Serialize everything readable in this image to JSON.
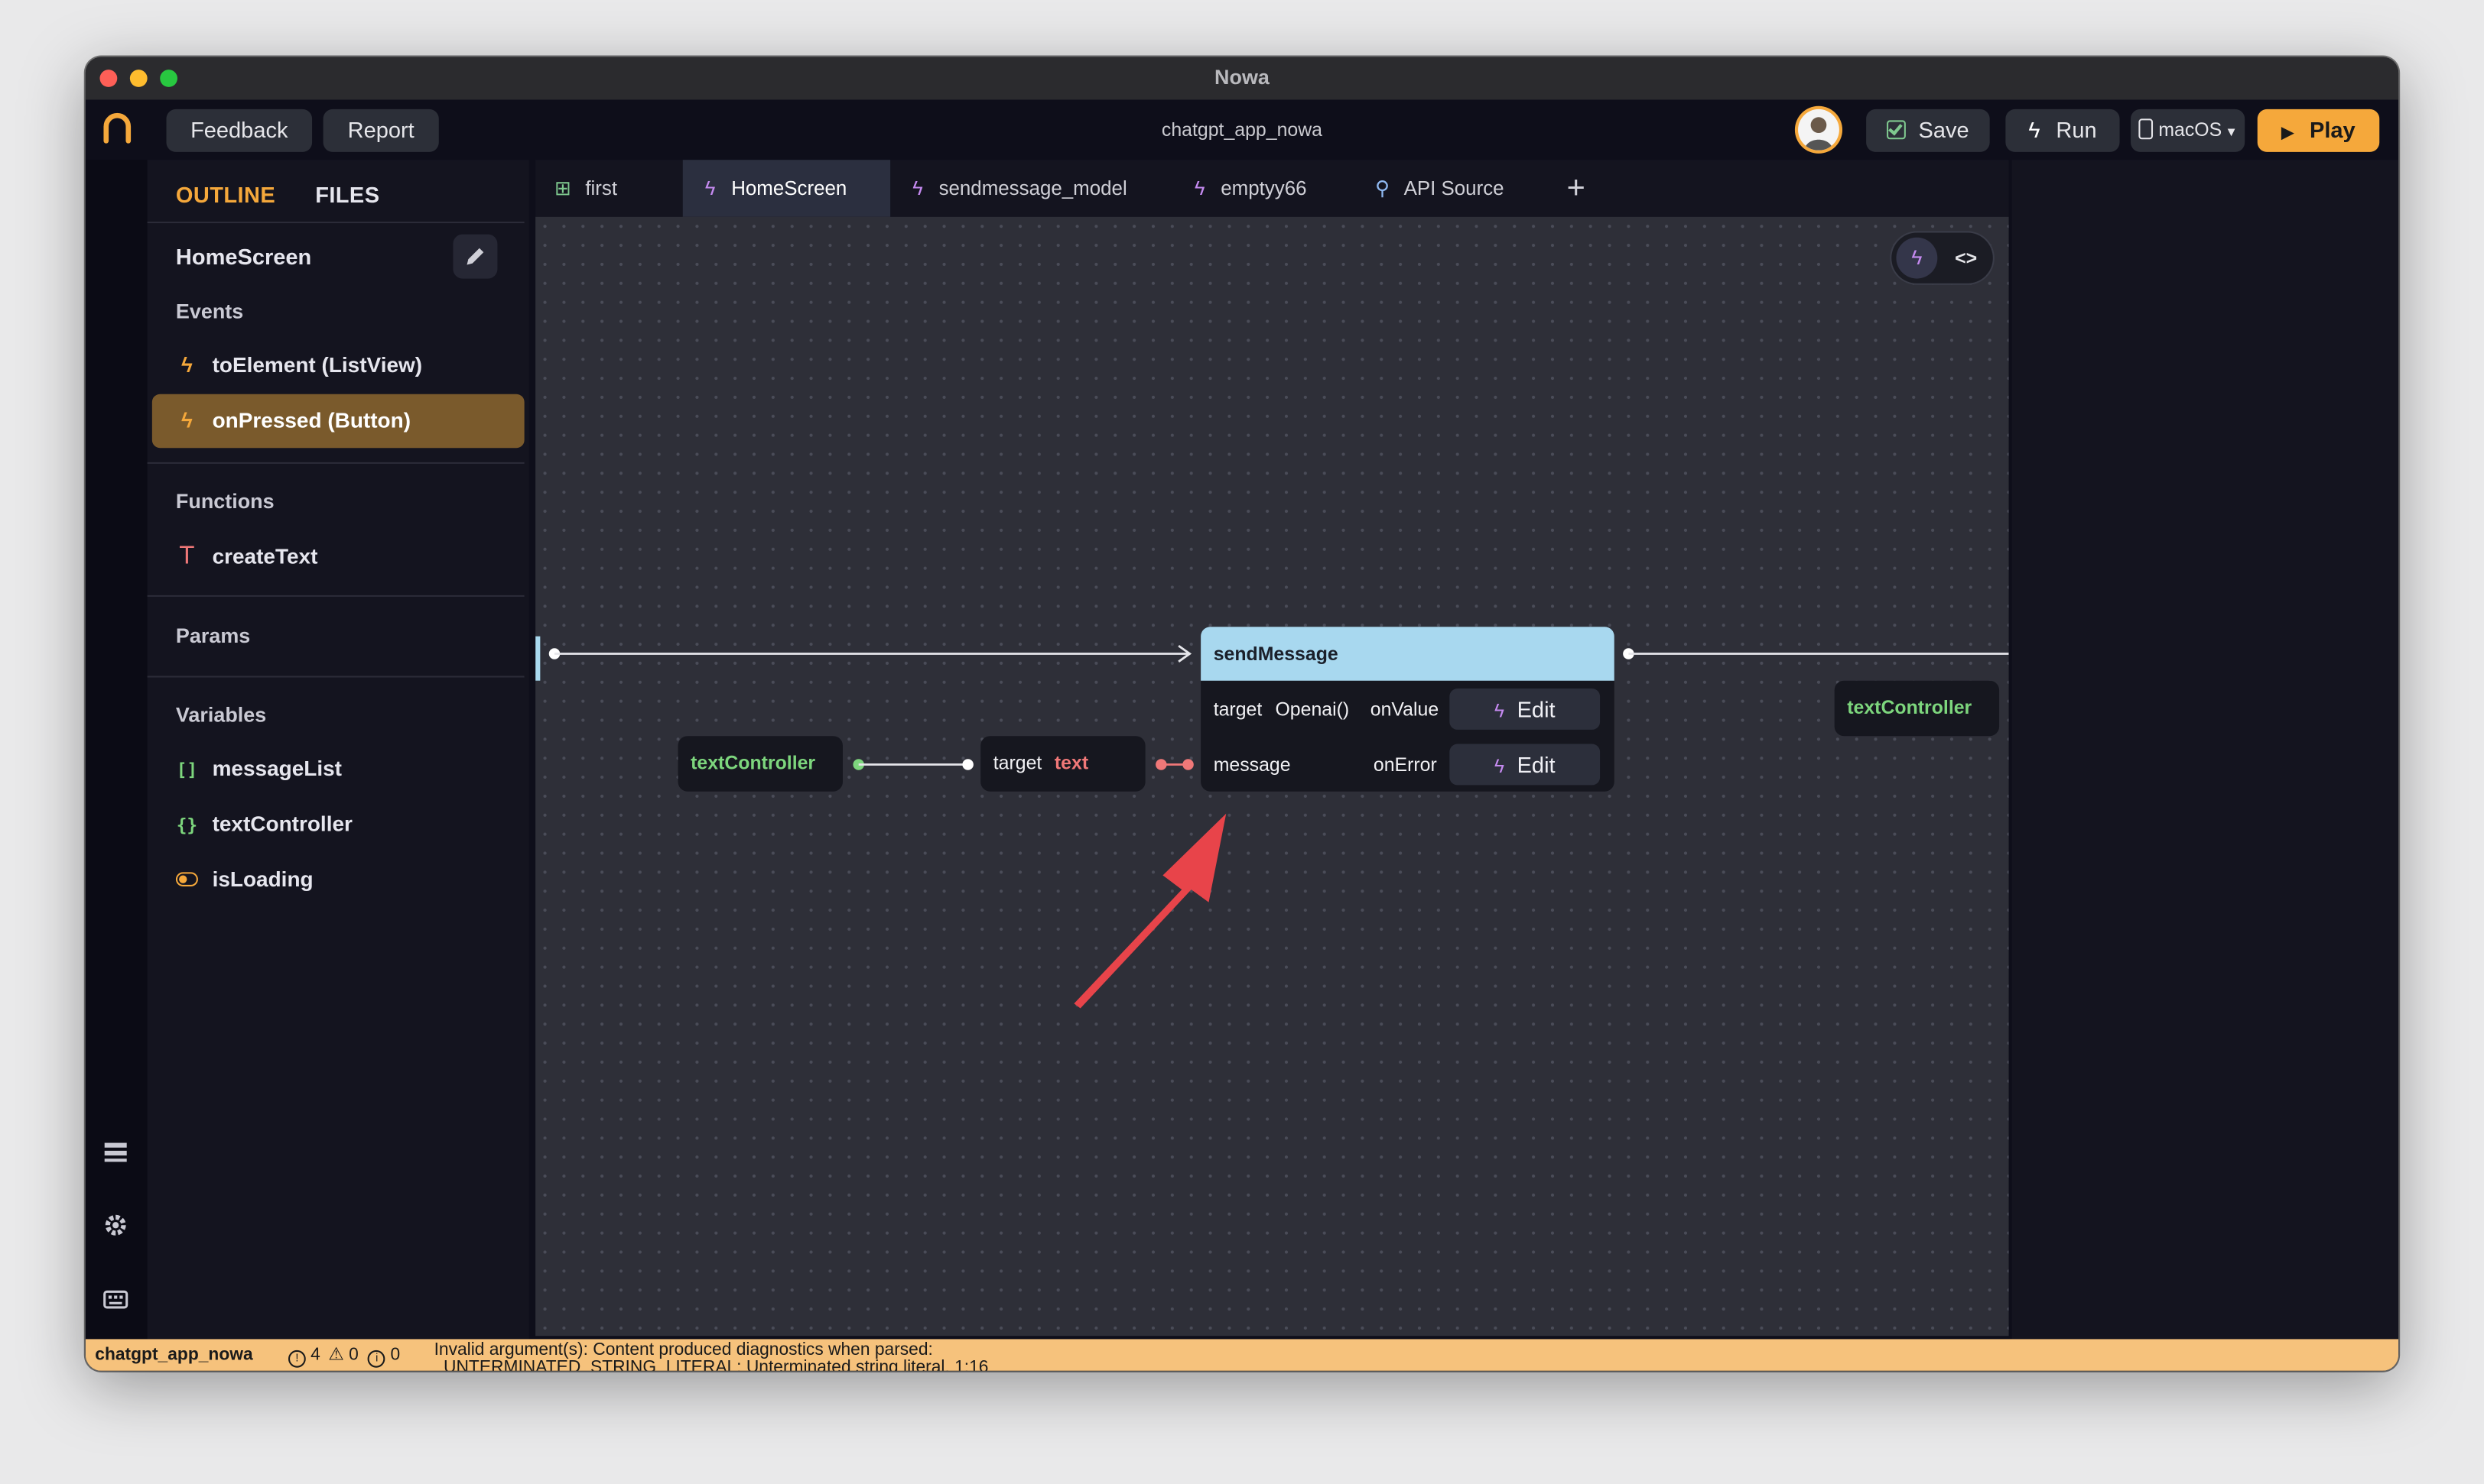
{
  "window": {
    "title": "Nowa"
  },
  "toolbar": {
    "feedback_label": "Feedback",
    "report_label": "Report",
    "project_title": "chatgpt_app_nowa",
    "save_label": "Save",
    "run_label": "Run",
    "platform_label": "macOS",
    "play_label": "Play"
  },
  "sidebar": {
    "tabs": [
      {
        "label": "OUTLINE",
        "active": true
      },
      {
        "label": "FILES",
        "active": false
      }
    ],
    "screen_name": "HomeScreen",
    "events_label": "Events",
    "events": [
      {
        "label": "toElement (ListView)",
        "icon": "bolt-icon",
        "selected": false
      },
      {
        "label": "onPressed (Button)",
        "icon": "bolt-icon",
        "selected": true
      }
    ],
    "functions_label": "Functions",
    "functions": [
      {
        "label": "createText",
        "icon": "text-type-icon"
      }
    ],
    "params_label": "Params",
    "variables_label": "Variables",
    "variables": [
      {
        "label": "messageList",
        "icon": "list-brackets-icon",
        "glyph": "[]"
      },
      {
        "label": "textController",
        "icon": "object-braces-icon",
        "glyph": "{}"
      },
      {
        "label": "isLoading",
        "icon": "toggle-icon"
      }
    ]
  },
  "tabs": [
    {
      "label": "first",
      "icon": "grid-icon",
      "active": false
    },
    {
      "label": "HomeScreen",
      "icon": "bolt-icon",
      "active": true
    },
    {
      "label": "sendmessage_model",
      "icon": "bolt-icon",
      "active": false
    },
    {
      "label": "emptyy66",
      "icon": "bolt-icon",
      "active": false
    },
    {
      "label": "API Source",
      "icon": "plug-icon",
      "active": false
    }
  ],
  "canvas": {
    "send_node": {
      "title": "sendMessage",
      "row1": {
        "param": "target",
        "value": "Openai()",
        "callback": "onValue",
        "action": "Edit"
      },
      "row2": {
        "param": "message",
        "callback": "onError",
        "action": "Edit"
      }
    },
    "left_text_controller": "textController",
    "target_node": {
      "param": "target",
      "value": "text"
    },
    "right_text_controller": "textController"
  },
  "status": {
    "project": "chatgpt_app_nowa",
    "errors": "4",
    "warnings": "0",
    "infos": "0",
    "message": "Invalid argument(s): Content produced diagnostics when parsed:",
    "message2": "UNTERMINATED_STRING_LITERAL: Unterminated string literal. 1:16"
  },
  "colors": {
    "accent": "#f5a83b",
    "selected_event_bg": "#7a5a2c",
    "node_header": "#a8d8ef",
    "status_bar": "#f6c27c",
    "annotation_arrow": "#e8444a"
  }
}
